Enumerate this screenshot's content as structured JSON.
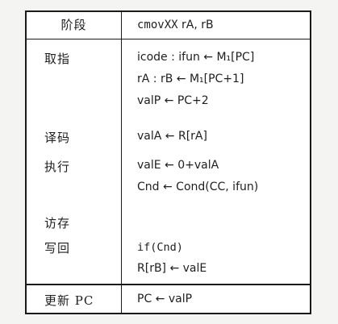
{
  "table": {
    "header": {
      "stage": "阶段",
      "instr_op": "cmovXX",
      "instr_args": " rA, rB"
    },
    "rows": [
      {
        "stage": "取指",
        "lines": [
          "icode : ifun ← M₁[PC]",
          "rA : rB ← M₁[PC+1]",
          "valP ← PC+2"
        ]
      },
      {
        "stage": "译码",
        "lines": [
          "valA ← R[rA]"
        ]
      },
      {
        "stage": "执行",
        "lines": [
          "valE ← 0+valA",
          "Cnd ← Cond(CC, ifun)"
        ]
      },
      {
        "stage": "访存",
        "lines": []
      },
      {
        "stage": "写回",
        "lines": [
          "if(Cnd)",
          "R[rB] ← valE"
        ]
      },
      {
        "stage": "更新 PC",
        "lines": [
          "PC ← valP"
        ]
      }
    ]
  }
}
